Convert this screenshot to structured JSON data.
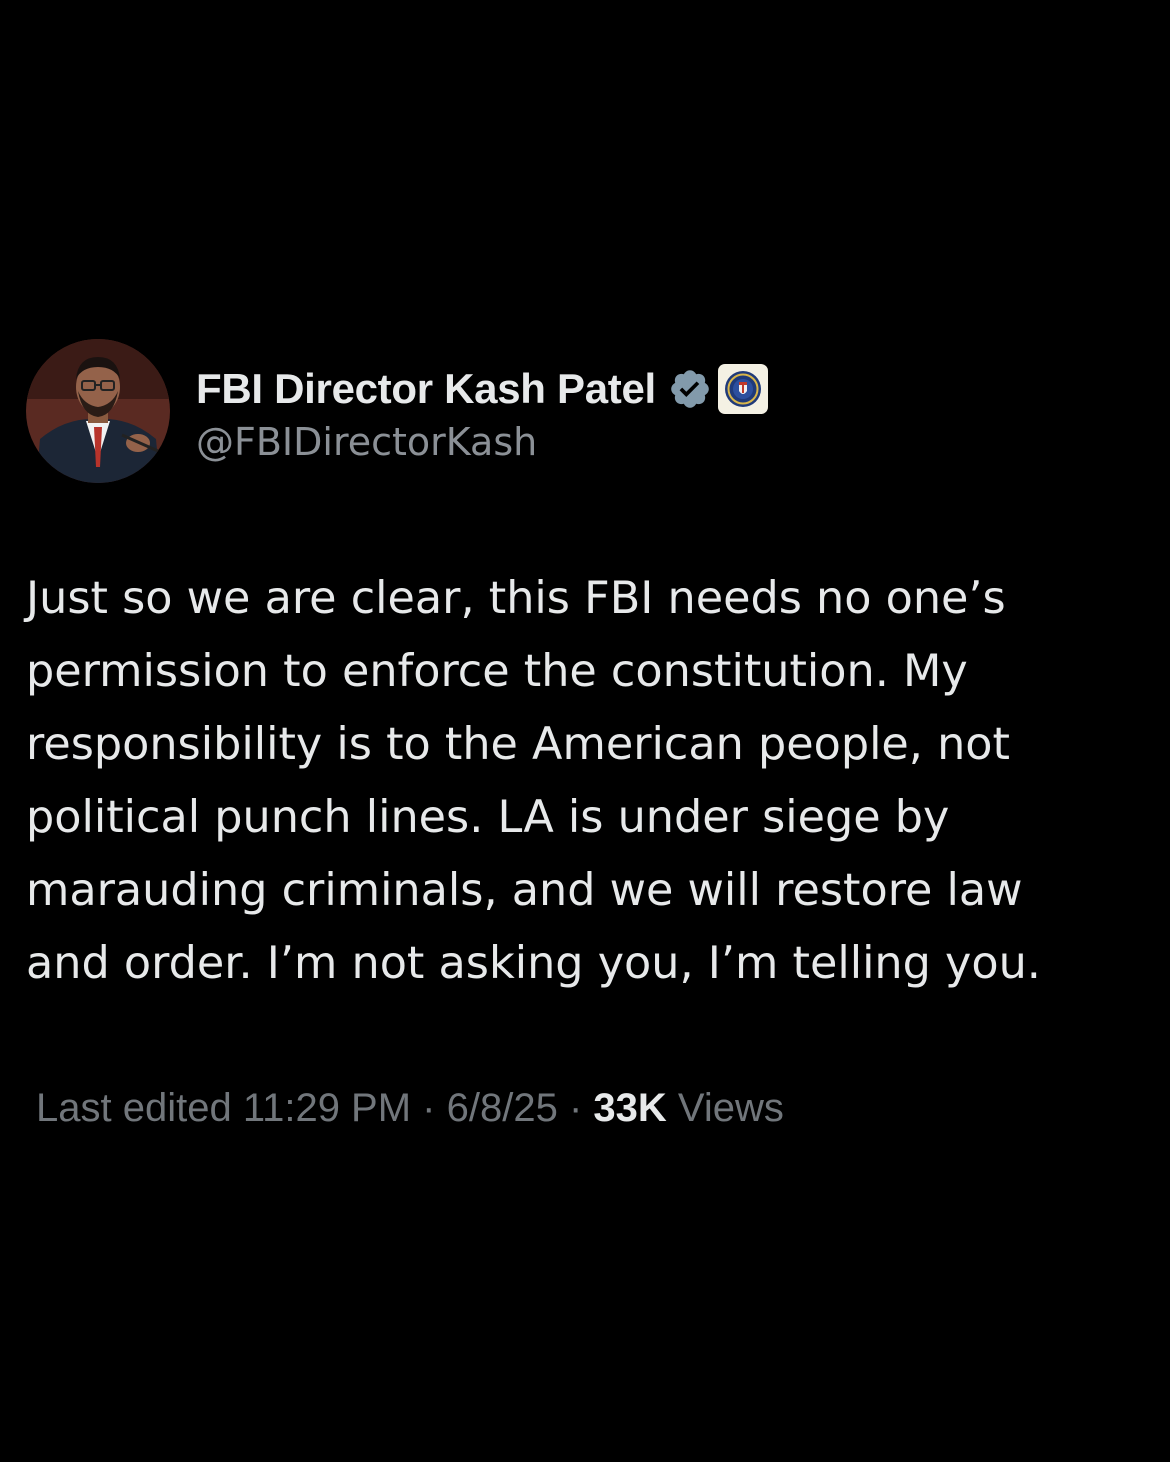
{
  "tweet": {
    "author": {
      "display_name": "FBI Director Kash Patel",
      "handle": "@FBIDirectorKash",
      "avatar_icon": "profile-photo-avatar",
      "verified_icon": "verified-badge-icon",
      "verified_color": "#829aab",
      "affiliate_icon": "fbi-seal-icon"
    },
    "text_lines": [
      "Just so we are clear, this FBI needs no one’s",
      "permission to enforce the constitution. My",
      "responsibility is to the American people, not",
      "political punch lines. LA is under siege by",
      "marauding criminals, and we will restore law",
      "and order. I’m not asking you, I’m telling you."
    ],
    "meta": {
      "edited_label": "Last edited 11:29 PM · 6/8/25",
      "separator": " · ",
      "views_count": "33K",
      "views_label": " Views"
    }
  },
  "colors": {
    "background": "#000000",
    "primary_text": "#e7e9ea",
    "secondary_text": "#71767b"
  }
}
